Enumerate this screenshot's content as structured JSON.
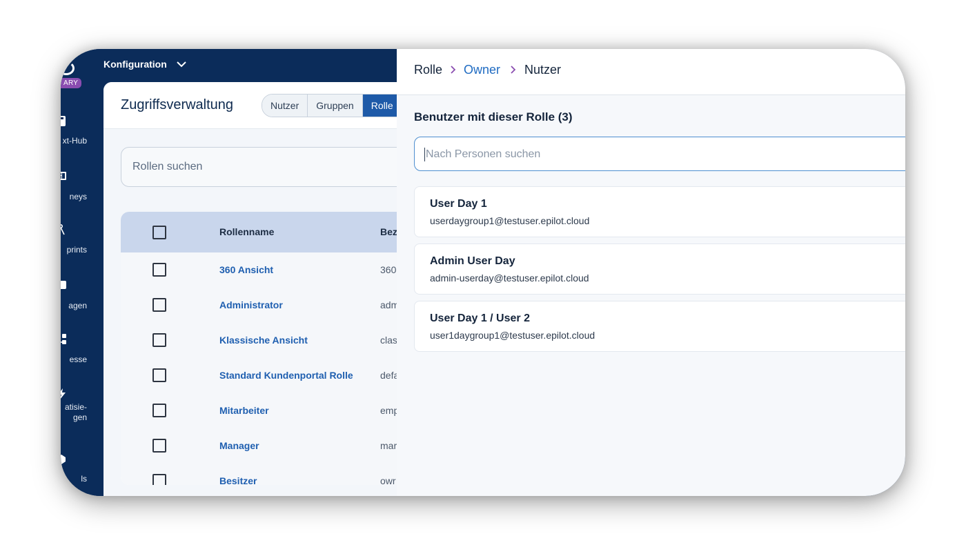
{
  "rail": {
    "badge": "ARY",
    "items": [
      {
        "label": "xt-Hub",
        "icon": "product-hub-icon"
      },
      {
        "label": "neys",
        "icon": "journeys-icon"
      },
      {
        "label": "prints",
        "icon": "blueprints-icon"
      },
      {
        "label": "agen",
        "icon": "anfragen-icon"
      },
      {
        "label": "esse",
        "icon": "prozesse-icon"
      },
      {
        "label": "atisie-\ngen",
        "icon": "automatisierungen-icon"
      },
      {
        "label": "ls",
        "icon": "tools-icon"
      }
    ]
  },
  "topbar": {
    "title": "Konfiguration",
    "chevron_icon": "chevron-down-icon"
  },
  "main": {
    "title": "Zugriffsverwaltung",
    "tabs": [
      "Nutzer",
      "Gruppen",
      "Rolle"
    ],
    "active_tab": "Rolle",
    "search_placeholder": "Rollen suchen",
    "table": {
      "columns": [
        "Rollenname",
        "Bez"
      ],
      "rows": [
        {
          "name": "360 Ansicht",
          "desc": "360"
        },
        {
          "name": "Administrator",
          "desc": "adm"
        },
        {
          "name": "Klassische Ansicht",
          "desc": "clas"
        },
        {
          "name": "Standard Kundenportal Rolle",
          "desc": "defa"
        },
        {
          "name": "Mitarbeiter",
          "desc": "emp"
        },
        {
          "name": "Manager",
          "desc": "mar"
        },
        {
          "name": "Besitzer",
          "desc": "owr"
        }
      ]
    }
  },
  "panel": {
    "breadcrumb": [
      "Rolle",
      "Owner",
      "Nutzer"
    ],
    "heading": "Benutzer mit dieser Rolle (3)",
    "search_placeholder": "Nach Personen suchen",
    "users": [
      {
        "name": "User Day 1",
        "email": "userdaygroup1@testuser.epilot.cloud"
      },
      {
        "name": "Admin User Day",
        "email": "admin-userday@testuser.epilot.cloud"
      },
      {
        "name": "User Day 1 / User 2",
        "email": "user1daygroup1@testuser.epilot.cloud"
      }
    ]
  },
  "colors": {
    "rail_bg": "#0b2c5a",
    "accent": "#1e5aa8",
    "link": "#1f6bc2",
    "breadcrumb_separator": "#8a4db0",
    "badge": "#8a4db0"
  }
}
